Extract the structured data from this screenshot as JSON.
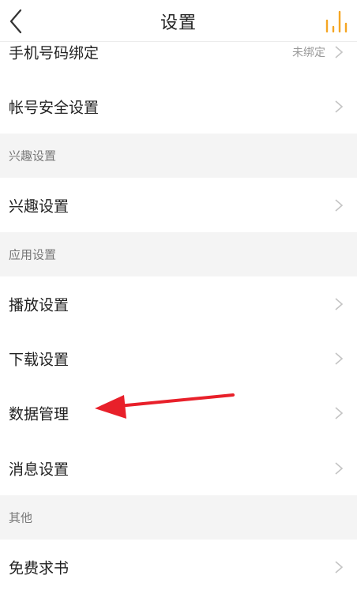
{
  "header": {
    "title": "设置",
    "accent_color": "#f5a623"
  },
  "rows": {
    "phone": {
      "label": "手机号码绑定",
      "value": "未绑定"
    },
    "account_security": {
      "label": "帐号安全设置"
    },
    "interest": {
      "label": "兴趣设置"
    },
    "playback": {
      "label": "播放设置"
    },
    "download": {
      "label": "下载设置"
    },
    "data_management": {
      "label": "数据管理"
    },
    "messages": {
      "label": "消息设置"
    },
    "free_books": {
      "label": "免费求书"
    }
  },
  "sections": {
    "interest": "兴趣设置",
    "app": "应用设置",
    "other": "其他"
  },
  "annotation": {
    "arrow_color": "#e8202a"
  }
}
